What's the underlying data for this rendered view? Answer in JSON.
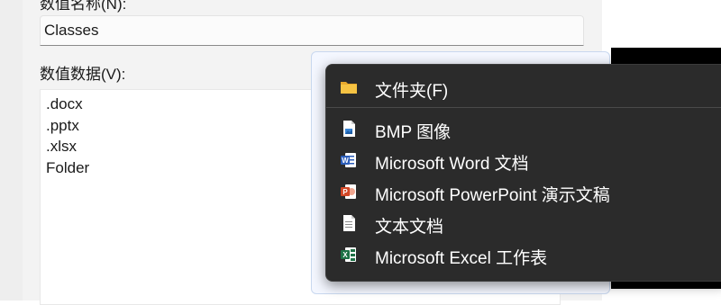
{
  "dialog": {
    "name_label": "数值名称(N):",
    "name_value": "Classes",
    "data_label": "数值数据(V):",
    "data_lines": [
      ".docx",
      ".pptx",
      ".xlsx",
      "Folder"
    ]
  },
  "context_menu": {
    "items": [
      {
        "label": "文件夹(F)",
        "icon": "folder-icon"
      },
      {
        "label": "BMP 图像",
        "icon": "bitmap-image-icon"
      },
      {
        "label": "Microsoft Word 文档",
        "icon": "word-document-icon"
      },
      {
        "label": "Microsoft PowerPoint 演示文稿",
        "icon": "powerpoint-presentation-icon"
      },
      {
        "label": "文本文档",
        "icon": "text-document-icon"
      },
      {
        "label": "Microsoft Excel 工作表",
        "icon": "excel-worksheet-icon"
      }
    ]
  },
  "colors": {
    "menu_background": "#2b2b2b",
    "folder": "#f6c343",
    "word": "#2b5db9",
    "powerpoint": "#d24726",
    "excel": "#1d7145"
  }
}
